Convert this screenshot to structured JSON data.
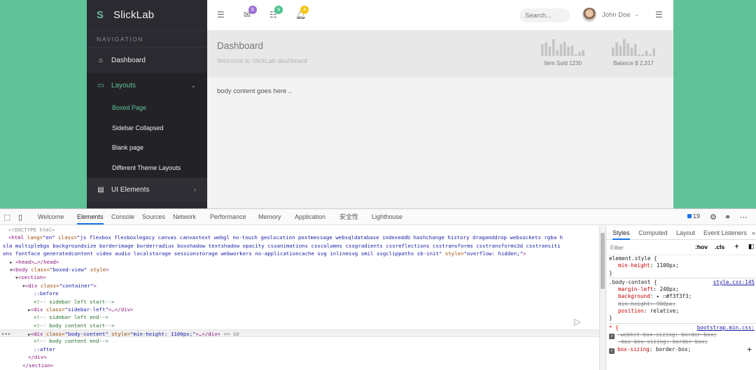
{
  "app": {
    "brand": "SlickLab",
    "nav_heading": "NAVIGATION",
    "nav": [
      {
        "label": "Dashboard",
        "icon": "home-icon"
      },
      {
        "label": "Layouts",
        "icon": "laptop-icon",
        "expanded": true
      },
      {
        "label": "UI Elements",
        "icon": "book-icon"
      }
    ],
    "layouts_sub": [
      {
        "label": "Boxed Page",
        "active": true
      },
      {
        "label": "Sidebar Collapsed"
      },
      {
        "label": "Blank page"
      },
      {
        "label": "Different Theme Layouts"
      }
    ],
    "topbar": {
      "mail_badge": "6",
      "tasks_badge": "9",
      "bell_badge": "4",
      "search_placeholder": "Search...",
      "user_name": "John Doe"
    },
    "colors": {
      "accent": "#5fc299",
      "mail_badge": "#9b6fd6",
      "tasks_badge": "#4cc28c",
      "bell_badge": "#f5c518",
      "sidebar_bg": "#2a2a30"
    },
    "page": {
      "title": "Dashboard",
      "subtitle": "Welcome to SlickLab dashboard",
      "body_text": "body content goes here .."
    },
    "stats": [
      {
        "label": "Item Sold 1230",
        "bars": [
          0.7,
          0.8,
          0.55,
          1.0,
          0.35,
          0.7,
          0.85,
          0.55,
          0.6,
          0.1,
          0.25,
          0.35
        ]
      },
      {
        "label": "Balance $ 2,317",
        "bars": [
          0.5,
          0.8,
          0.6,
          1.0,
          0.75,
          0.5,
          0.7,
          0.1,
          0.1,
          0.3,
          0.1,
          0.45
        ]
      }
    ]
  },
  "devtools": {
    "tabs": [
      "Welcome",
      "Elements",
      "Console",
      "Sources",
      "Network",
      "Performance",
      "Memory",
      "Application",
      "安全性",
      "Lighthouse"
    ],
    "active_tab": "Elements",
    "issues_count": "19",
    "dom": {
      "doctype": "<!DOCTYPE html>",
      "html_open": "<html",
      "html_lang_attr": " lang=",
      "html_lang_val": "\"en\"",
      "html_class_attr": " class=",
      "html_class_line1": "\"js flexbox flexboxlegacy canvas canvastext webgl no-touch geolocation postmessage websqldatabase indexeddb hashchange history draganddrop websockets rgba h",
      "html_class_line2": "sla multiplebgs backgroundsize borderimage borderradius boxshadow textshadow opacity cssanimations csscolumns cssgradients cssreflections csstransforms csstransforms3d csstransiti",
      "html_class_line3": "ons fontface generatedcontent video audio localstorage sessionstorage webworkers no-applicationcache svg inlinesvg smil svgclippaths sb-init\"",
      "html_style_attr": " style=",
      "html_style_val": "\"overflow: hidden;\"",
      "head": "<head>…</head>",
      "body_open": "<body",
      "body_class_val": "\"boxed-view\"",
      "section_open": "<section>",
      "div_container": "<div",
      "container_val": "\"container\"",
      "before": "::before",
      "c_sidebar_start": "<!-- sidebar left start-->",
      "sidebar_val": "\"sidebar-left\"",
      "c_sidebar_end": "<!-- sidebar left end-->",
      "c_body_start": "<!-- body content start-->",
      "body_content_val": "\"body-content\"",
      "body_content_style": "\"min-height: 1100px;\"",
      "selected_marker": "== $0",
      "c_body_end": "<!-- body content end-->",
      "after": "::after",
      "div_close": "</div>",
      "section_close": "</section>"
    },
    "styles": {
      "tabs": [
        "Styles",
        "Computed",
        "Layout",
        "Event Listeners"
      ],
      "active_tab": "Styles",
      "filter_placeholder": "Filter",
      "hov": ":hov",
      "cls": ".cls",
      "rules": [
        {
          "selector": "element.style {",
          "source": "",
          "props": [
            {
              "name": "min-height",
              "value": "1100px;",
              "struck": false
            }
          ]
        },
        {
          "selector": ".body-content {",
          "source": "style.css:145",
          "props": [
            {
              "name": "margin-left",
              "value": "240px;",
              "struck": false
            },
            {
              "name": "background",
              "value": "▸ ☐#f3f3f3;",
              "struck": false
            },
            {
              "name": "min-height",
              "value": "900px;",
              "struck": true
            },
            {
              "name": "position",
              "value": "relative;",
              "struck": false
            }
          ]
        },
        {
          "selector": "* {",
          "source": "bootstrap.min.css:",
          "props": [
            {
              "name": "-webkit-box-sizing",
              "value": "border-box;",
              "struck": true,
              "checked": true
            },
            {
              "name": "-moz-box-sizing",
              "value": "border-box;",
              "struck": true
            },
            {
              "name": "box-sizing",
              "value": "border-box;",
              "struck": false,
              "checked": true
            }
          ]
        }
      ]
    }
  }
}
